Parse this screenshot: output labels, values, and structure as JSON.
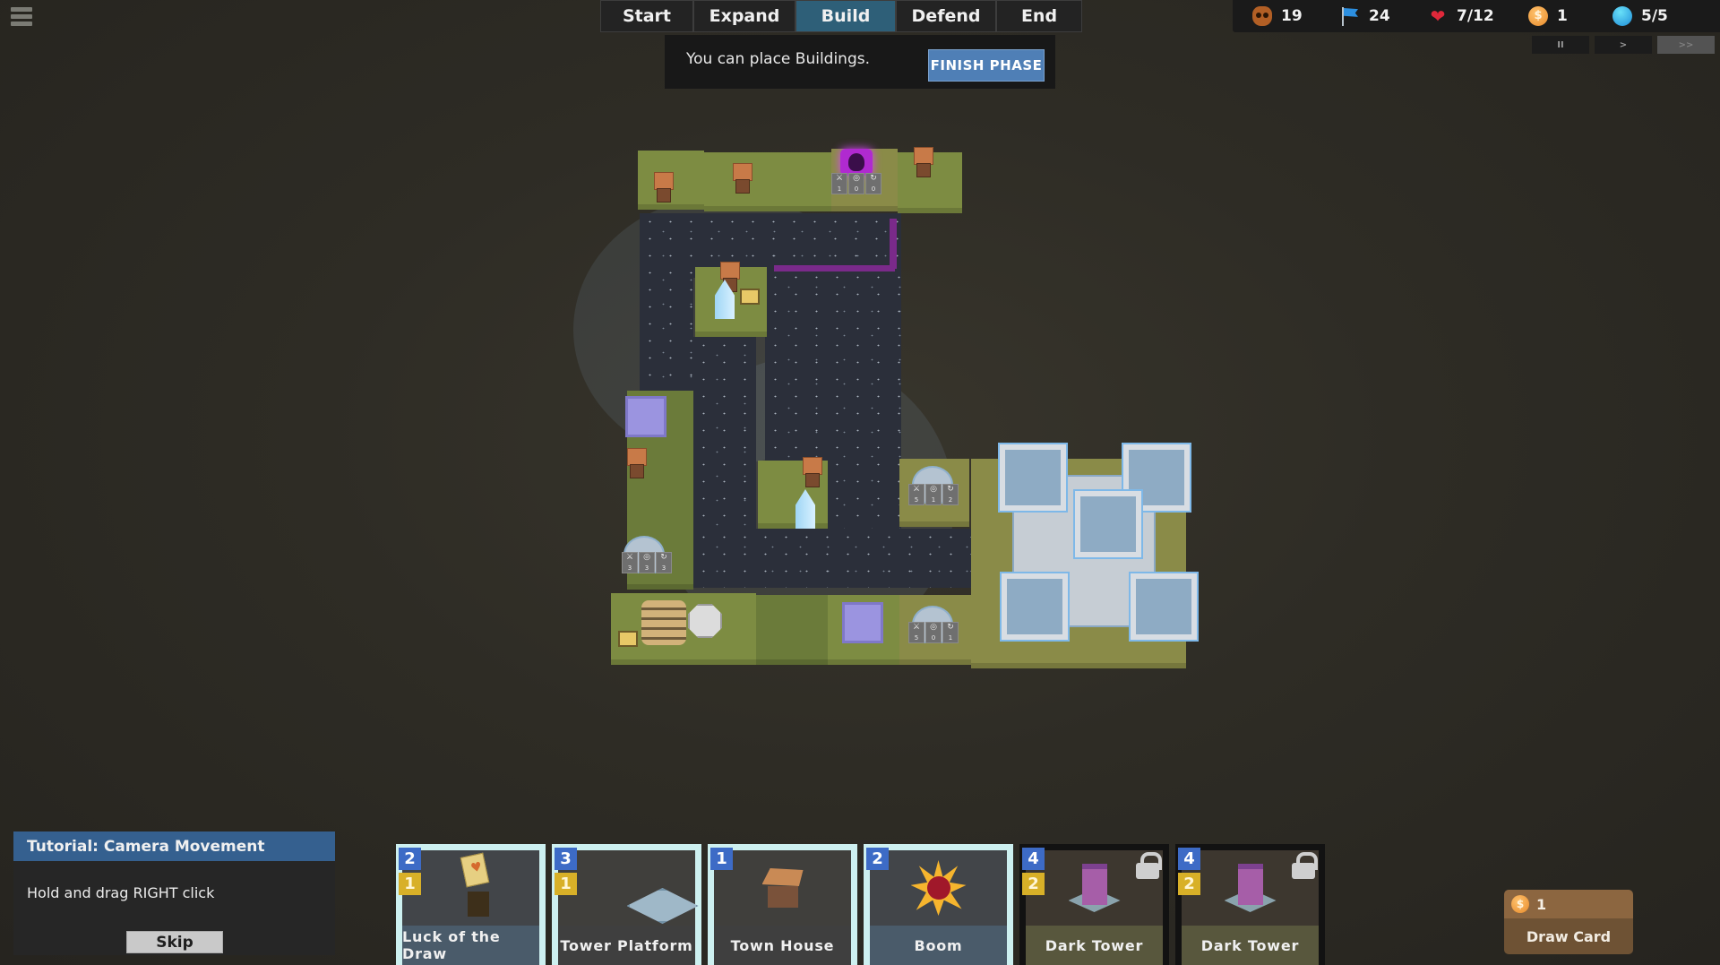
{
  "menu": {
    "icon": "hamburger-menu-icon"
  },
  "phases": {
    "tabs": [
      {
        "label": "Start",
        "active": false
      },
      {
        "label": "Expand",
        "active": false
      },
      {
        "label": "Build",
        "active": true
      },
      {
        "label": "Defend",
        "active": false
      },
      {
        "label": "End",
        "active": false
      }
    ],
    "message": "You can place Buildings.",
    "finish_label": "FINISH PHASE"
  },
  "resources": {
    "enemies": {
      "icon": "skull-icon",
      "value": "19"
    },
    "wave": {
      "icon": "flag-icon",
      "value": "24"
    },
    "health": {
      "icon": "heart-icon",
      "value": "7/12"
    },
    "gold": {
      "icon": "coin-icon",
      "value": "1"
    },
    "mana": {
      "icon": "orb-icon",
      "value": "5/5"
    }
  },
  "speed": {
    "pause": "II",
    "play": ">",
    "fast": ">>",
    "active": "fast"
  },
  "board": {
    "tower_stats": [
      {
        "damage": "1",
        "range": "0",
        "speed": "0"
      },
      {
        "damage": "5",
        "range": "1",
        "speed": "2"
      },
      {
        "damage": "3",
        "range": "3",
        "speed": "3"
      },
      {
        "damage": "5",
        "range": "0",
        "speed": "1"
      }
    ]
  },
  "tutorial": {
    "title": "Tutorial: Camera Movement",
    "body": "Hold and drag RIGHT click",
    "skip_label": "Skip"
  },
  "cards": [
    {
      "name": "Luck of the Draw",
      "cost": "2",
      "gold": "1",
      "locked": false,
      "icon": "luck-of-the-draw-icon"
    },
    {
      "name": "Tower Platform",
      "cost": "3",
      "gold": "1",
      "locked": false,
      "icon": "tower-platform-icon"
    },
    {
      "name": "Town House",
      "cost": "1",
      "gold": null,
      "locked": false,
      "icon": "town-house-icon"
    },
    {
      "name": "Boom",
      "cost": "2",
      "gold": null,
      "locked": false,
      "icon": "explosion-icon"
    },
    {
      "name": "Dark Tower",
      "cost": "4",
      "gold": "2",
      "locked": true,
      "icon": "dark-tower-icon"
    },
    {
      "name": "Dark Tower",
      "cost": "4",
      "gold": "2",
      "locked": true,
      "icon": "dark-tower-icon"
    }
  ],
  "draw_card": {
    "cost": "1",
    "label": "Draw Card"
  },
  "colors": {
    "active_phase": "#2e5f78",
    "finish_button": "#4f7fb6",
    "tutorial_header": "#35608f",
    "cost_badge": "#3d6bc6",
    "gold_badge": "#d8b028",
    "card_highlight": "#cdf0f0"
  }
}
